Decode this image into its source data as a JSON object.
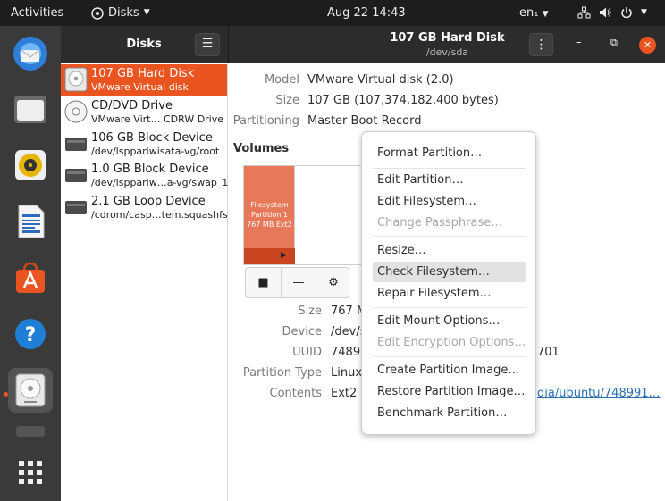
{
  "topbar": {
    "activities": "Activities",
    "app_menu": "Disks",
    "clock": "Aug 22  14:43",
    "language": "en₁"
  },
  "dock": {
    "items": [
      {
        "name": "Thunderbird Mail",
        "icon": "thunderbird-icon"
      },
      {
        "name": "Files",
        "icon": "files-icon"
      },
      {
        "name": "Rhythmbox",
        "icon": "rhythmbox-icon"
      },
      {
        "name": "LibreOffice Writer",
        "icon": "writer-icon"
      },
      {
        "name": "Ubuntu Software",
        "icon": "software-icon"
      },
      {
        "name": "Help",
        "icon": "help-icon"
      },
      {
        "name": "Disks",
        "icon": "disks-icon",
        "active": true
      },
      {
        "name": "Show Applications",
        "icon": "app-grid-icon"
      }
    ]
  },
  "sidebar": {
    "title": "Disks",
    "devices": [
      {
        "name": "107 GB Hard Disk",
        "sub": "VMware Virtual disk",
        "selected": true,
        "icon": "hard-disk-icon"
      },
      {
        "name": "CD/DVD Drive",
        "sub": "VMware Virt… CDRW Drive",
        "selected": false,
        "icon": "optical-drive-icon"
      },
      {
        "name": "106 GB Block Device",
        "sub": "/dev/lsppariwisata-vg/root",
        "selected": false,
        "icon": "block-device-icon"
      },
      {
        "name": "1.0 GB Block Device",
        "sub": "/dev/lsppariw…a-vg/swap_1",
        "selected": false,
        "icon": "block-device-icon"
      },
      {
        "name": "2.1 GB Loop Device",
        "sub": "/cdrom/casp…tem.squashfs",
        "selected": false,
        "icon": "loop-device-icon"
      }
    ]
  },
  "header": {
    "title": "107 GB Hard Disk",
    "subtitle": "/dev/sda"
  },
  "disk_info": {
    "model_label": "Model",
    "model_value": "VMware Virtual disk (2.0)",
    "size_label": "Size",
    "size_value": "107 GB (107,374,182,400 bytes)",
    "partitioning_label": "Partitioning",
    "partitioning_value": "Master Boot Record"
  },
  "volumes": {
    "title": "Volumes",
    "partition_lines": [
      "Filesystem",
      "Partition 1",
      "767 MB Ext2"
    ]
  },
  "partition_info": {
    "size_label": "Size",
    "size_value": "767 M",
    "device_label": "Device",
    "device_value": "/dev/s",
    "uuid_label": "UUID",
    "uuid_value": "74899",
    "uuid_tail": "701",
    "type_label": "Partition Type",
    "type_value": "Linux",
    "contents_label": "Contents",
    "contents_value": "Ext2 (",
    "contents_link": "dia/ubuntu/748991…"
  },
  "menu": {
    "items": [
      {
        "label": "Format Partition…",
        "enabled": true
      },
      {
        "label": "Edit Partition…",
        "enabled": true
      },
      {
        "label": "Edit Filesystem…",
        "enabled": true
      },
      {
        "label": "Change Passphrase…",
        "enabled": false
      },
      {
        "label": "Resize…",
        "enabled": true
      },
      {
        "label": "Check Filesystem…",
        "enabled": true,
        "hovered": true
      },
      {
        "label": "Repair Filesystem…",
        "enabled": true
      },
      {
        "label": "Edit Mount Options…",
        "enabled": true
      },
      {
        "label": "Edit Encryption Options…",
        "enabled": false
      },
      {
        "label": "Create Partition Image…",
        "enabled": true
      },
      {
        "label": "Restore Partition Image…",
        "enabled": true
      },
      {
        "label": "Benchmark Partition…",
        "enabled": true
      }
    ]
  },
  "colors": {
    "accent": "#e95420",
    "header_bg": "#2c2c2c",
    "dock_bg": "#3a3a3a",
    "topbar_bg": "#1d1d1d",
    "link": "#2a6fb3"
  }
}
